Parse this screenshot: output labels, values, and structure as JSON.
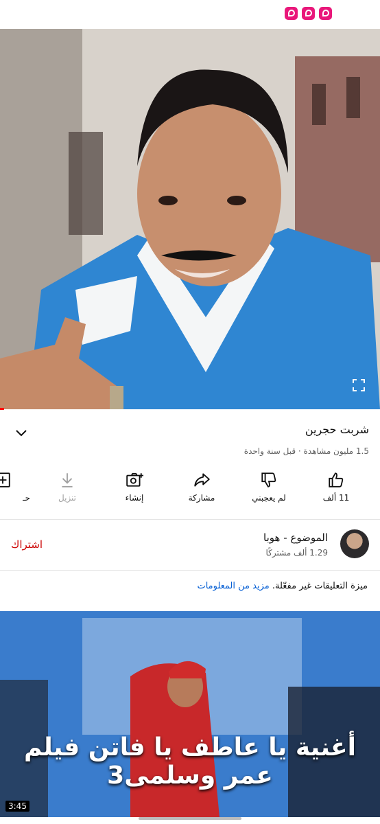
{
  "status_bar": {
    "badges": [
      "app-badge-icon",
      "app-badge-icon",
      "app-badge-icon"
    ],
    "badge_color": "#e9177a"
  },
  "video": {
    "fullscreen_icon": "fullscreen-icon",
    "progress_fraction": 0.01
  },
  "title": "شربت حجرين",
  "meta": "1.5 مليون مشاهدة · قبل سنة واحدة",
  "actions": [
    {
      "id": "like",
      "label": "11 ألف",
      "icon": "thumbs-up-icon"
    },
    {
      "id": "dislike",
      "label": "لم يعجبني",
      "icon": "thumbs-down-icon"
    },
    {
      "id": "share",
      "label": "مشاركة",
      "icon": "share-icon"
    },
    {
      "id": "create",
      "label": "إنشاء",
      "icon": "create-icon"
    },
    {
      "id": "download",
      "label": "تنزيل",
      "icon": "download-icon"
    },
    {
      "id": "save",
      "label": "حـ",
      "icon": "add-playlist-icon"
    }
  ],
  "channel": {
    "name": "الموضوع - هوبا",
    "subscribers": "1.29 ألف مشتركًا",
    "subscribe_label": "اشتراك"
  },
  "comments": {
    "text": "ميزة التعليقات غير مفعّلة.",
    "link": "مزيد من المعلومات"
  },
  "next_video": {
    "caption": "أغنية يا عاطف يا فاتن فيلم عمر وسلمى3",
    "duration": "3:45"
  },
  "colors": {
    "accent_red": "#ff0000",
    "subscribe_red": "#cc0000",
    "link_blue": "#065fd4"
  }
}
